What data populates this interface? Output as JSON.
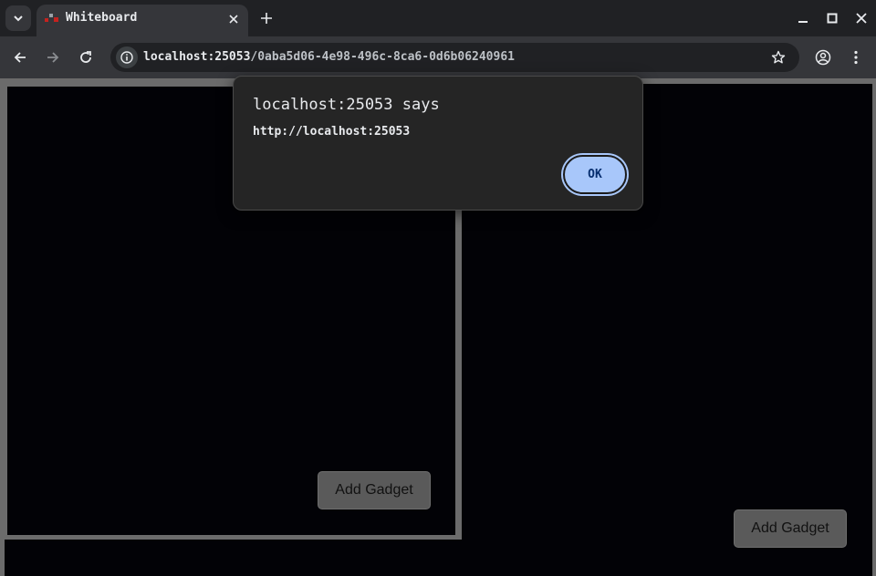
{
  "browser": {
    "tab": {
      "title": "Whiteboard"
    },
    "address_bar": {
      "host": "localhost:25053",
      "path": "/0aba5d06-4e98-496c-8ca6-0d6b06240961"
    },
    "icons": {
      "tab_search": "chevron-down-icon",
      "favicon": "whiteboard-favicon",
      "tab_close": "close-icon",
      "new_tab": "plus-icon",
      "minimize": "minimize-icon",
      "maximize": "maximize-icon",
      "window_close": "close-icon",
      "back": "arrow-left-icon",
      "forward": "arrow-right-icon",
      "reload": "reload-icon",
      "site_info": "info-icon",
      "bookmark": "star-icon",
      "profile": "account-icon",
      "menu": "kebab-menu-icon"
    }
  },
  "page": {
    "boards": [
      {
        "button_label": "Add Gadget"
      },
      {
        "button_label": "Add Gadget"
      }
    ]
  },
  "dialog": {
    "title": "localhost:25053 says",
    "message": "http://localhost:25053",
    "ok_label": "OK"
  },
  "colors": {
    "board_background": "#020206",
    "page_background": "#6b6b6b",
    "ok_button": "#a8c7fa"
  }
}
